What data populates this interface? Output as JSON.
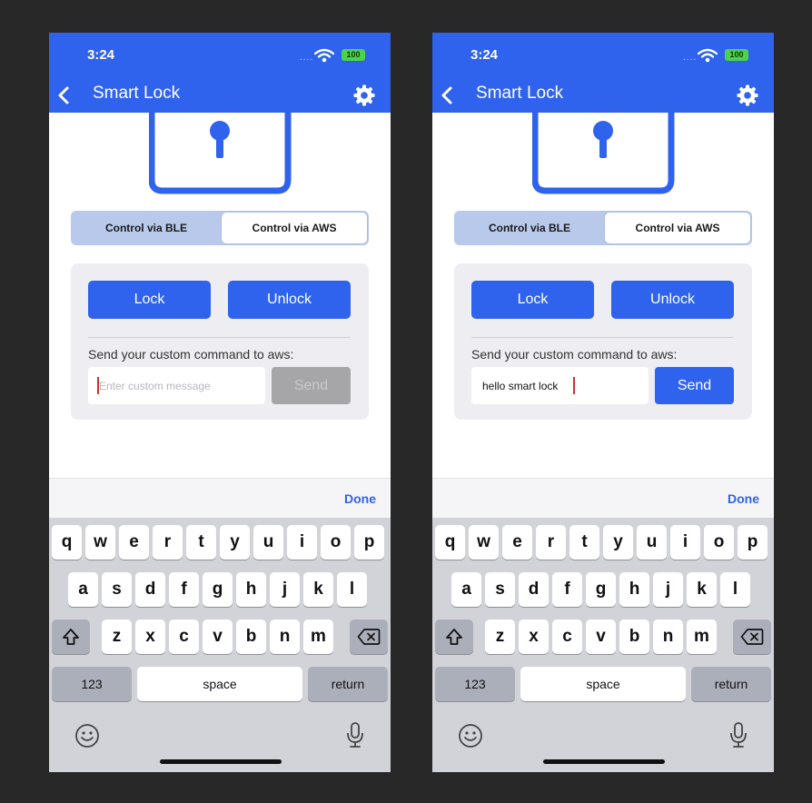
{
  "colors": {
    "accent": "#2f63ee",
    "background": "#282828",
    "keyboard": "#d1d3d9"
  },
  "screens": [
    {
      "status": {
        "time": "3:24",
        "signal": "....",
        "battery": "100"
      },
      "nav": {
        "title": "Smart Lock",
        "back_icon": "chevron-left-icon",
        "settings_icon": "gear-icon"
      },
      "segments": {
        "ble": "Control via BLE",
        "aws": "Control via AWS",
        "selected": "Control via AWS"
      },
      "panel": {
        "lock_label": "Lock",
        "unlock_label": "Unlock",
        "command_label": "Send your custom command to aws:",
        "input_value": "",
        "input_placeholder": "Enter custom message",
        "send_label": "Send",
        "send_enabled": false
      },
      "toolbar": {
        "done_label": "Done"
      }
    },
    {
      "status": {
        "time": "3:24",
        "signal": "....",
        "battery": "100"
      },
      "nav": {
        "title": "Smart Lock",
        "back_icon": "chevron-left-icon",
        "settings_icon": "gear-icon"
      },
      "segments": {
        "ble": "Control via BLE",
        "aws": "Control via AWS",
        "selected": "Control via AWS"
      },
      "panel": {
        "lock_label": "Lock",
        "unlock_label": "Unlock",
        "command_label": "Send your custom command to aws:",
        "input_value": "hello smart lock",
        "input_placeholder": "Enter custom message",
        "send_label": "Send",
        "send_enabled": true
      },
      "toolbar": {
        "done_label": "Done"
      }
    }
  ],
  "keyboard": {
    "row1": [
      "q",
      "w",
      "e",
      "r",
      "t",
      "y",
      "u",
      "i",
      "o",
      "p"
    ],
    "row2": [
      "a",
      "s",
      "d",
      "f",
      "g",
      "h",
      "j",
      "k",
      "l"
    ],
    "row3": [
      "z",
      "x",
      "c",
      "v",
      "b",
      "n",
      "m"
    ],
    "numbers_label": "123",
    "space_label": "space",
    "return_label": "return",
    "shift_icon": "shift-icon",
    "delete_icon": "delete-icon",
    "emoji_icon": "emoji-icon",
    "mic_icon": "microphone-icon"
  }
}
